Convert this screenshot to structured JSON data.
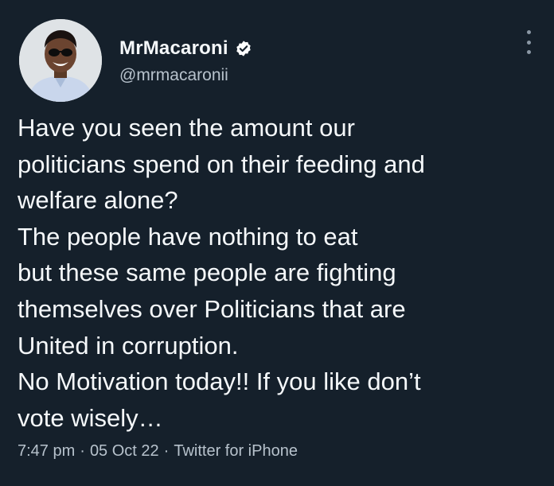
{
  "author": {
    "display_name": "MrMacaroni",
    "handle": "@mrmacaronii",
    "verified": true,
    "avatar_icon": "profile-photo"
  },
  "menu": {
    "icon": "more-vertical-icon"
  },
  "tweet": {
    "lines": [
      "Have you seen the amount our",
      "politicians spend on their feeding and",
      "welfare alone?",
      "The people have nothing to eat",
      "but these same people are fighting",
      "themselves over Politicians that are",
      "United in corruption.",
      "No Motivation today!! If you like don’t",
      "vote wisely…"
    ]
  },
  "meta": {
    "time": "7:47 pm",
    "separator": "·",
    "date": "05 Oct 22",
    "source": "Twitter for iPhone"
  },
  "colors": {
    "background": "#15202b",
    "text_primary": "#f5f8fa",
    "text_secondary": "#b7c2cc",
    "verified_badge": "#ffffff"
  }
}
